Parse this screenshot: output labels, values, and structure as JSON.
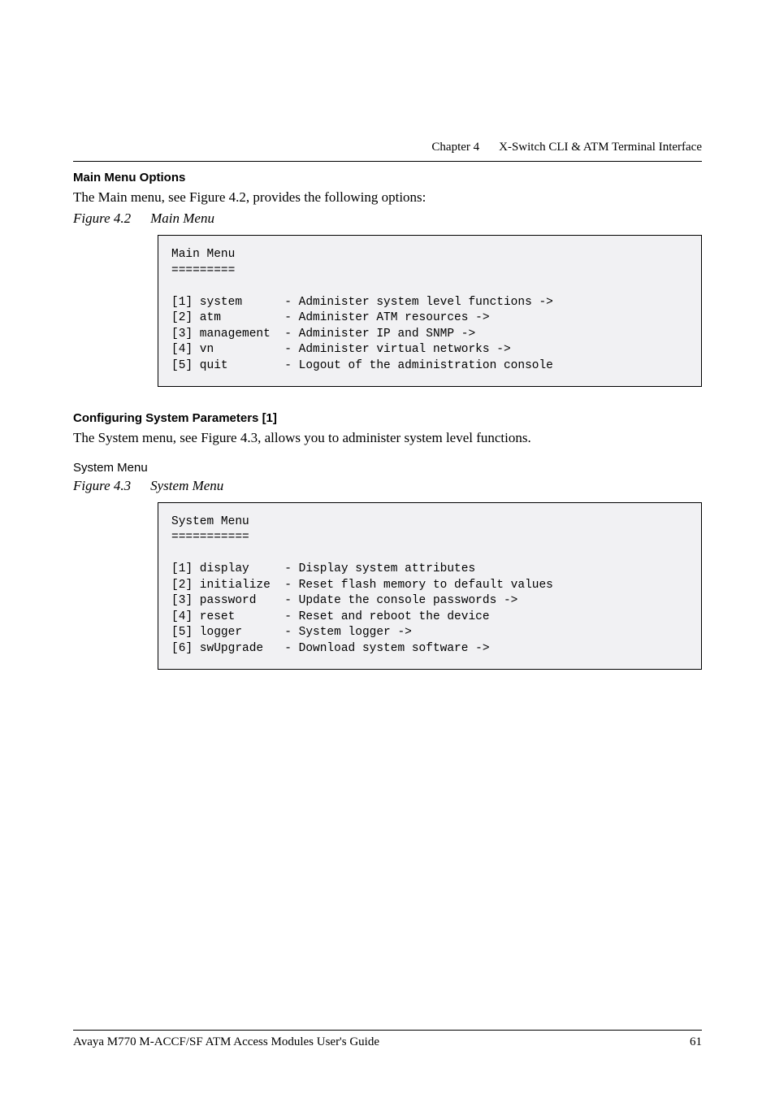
{
  "header": {
    "chapter_label": "Chapter 4",
    "chapter_title": "X-Switch CLI & ATM Terminal Interface"
  },
  "section1": {
    "heading": "Main Menu Options",
    "intro": "The Main menu, see Figure 4.2, provides the following options:",
    "figure_num": "Figure 4.2",
    "figure_title": "Main Menu",
    "code": "Main Menu\n=========\n\n[1] system      - Administer system level functions ->\n[2] atm         - Administer ATM resources ->\n[3] management  - Administer IP and SNMP ->\n[4] vn          - Administer virtual networks ->\n[5] quit        - Logout of the administration console"
  },
  "section2": {
    "heading": "Configuring System Parameters [1]",
    "intro": "The System menu, see Figure 4.3, allows you to administer system level functions.",
    "sub_label": "System Menu",
    "figure_num": "Figure 4.3",
    "figure_title": "System Menu",
    "code": "System Menu\n===========\n\n[1] display     - Display system attributes\n[2] initialize  - Reset flash memory to default values\n[3] password    - Update the console passwords ->\n[4] reset       - Reset and reboot the device\n[5] logger      - System logger ->\n[6] swUpgrade   - Download system software ->"
  },
  "footer": {
    "left": "Avaya M770 M-ACCF/SF ATM Access Modules User's Guide",
    "right": "61"
  }
}
